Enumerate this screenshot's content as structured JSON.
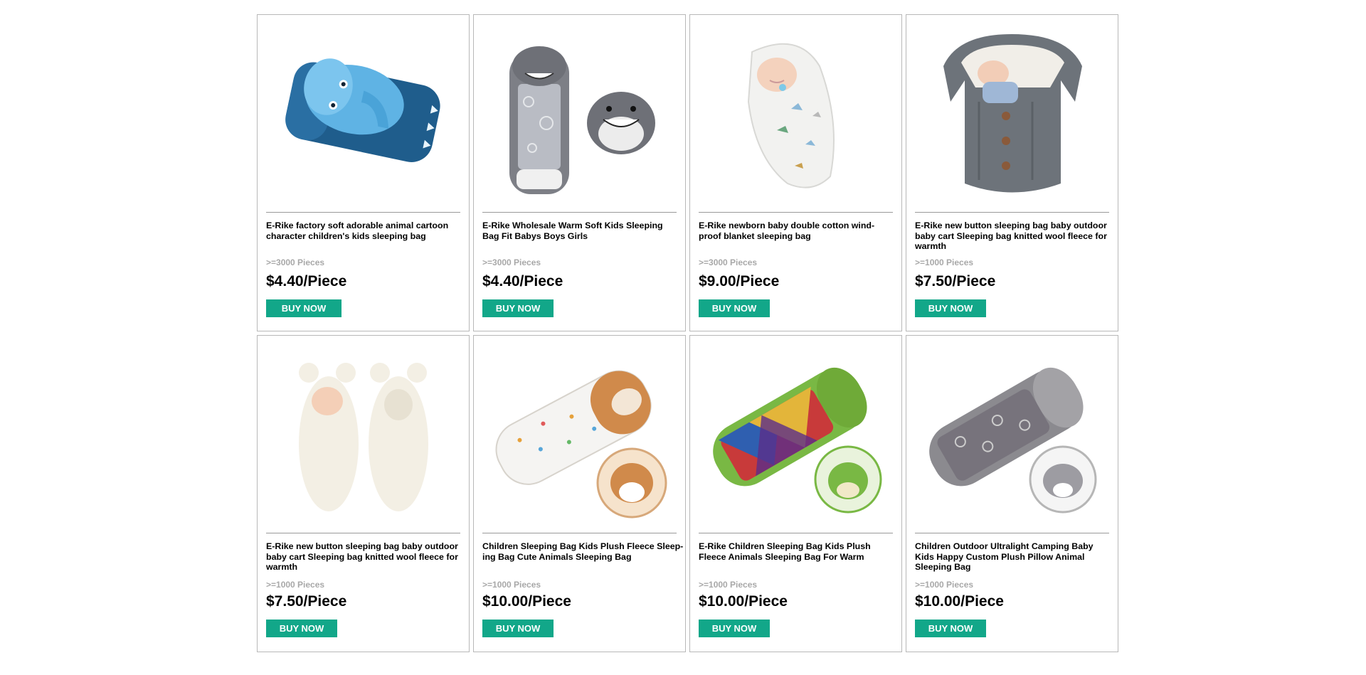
{
  "products": [
    {
      "title": "E-Rike factory soft adorable animal cartoon\ncharacter children's kids sleeping bag",
      "moq": ">=3000 Pieces",
      "price": "$4.40/Piece",
      "buy_label": "BUY NOW",
      "image": "elephant-sleeping-bag-image"
    },
    {
      "title": "E-Rike Wholesale Warm Soft Kids Sleeping\nBag Fit Babys Boys Girls",
      "moq": ">=3000 Pieces",
      "price": "$4.40/Piece",
      "buy_label": "BUY NOW",
      "image": "shark-sleeping-bag-image"
    },
    {
      "title": "E-Rike newborn baby double cotton wind-\nproof blanket sleeping bag",
      "moq": ">=3000 Pieces",
      "price": "$9.00/Piece",
      "buy_label": "BUY NOW",
      "image": "newborn-blanket-image"
    },
    {
      "title": "E-Rike new button sleeping bag baby outdoor\nbaby cart Sleeping bag knitted wool fleece for\nwarmth",
      "moq": ">=1000 Pieces",
      "price": "$7.50/Piece",
      "buy_label": "BUY NOW",
      "image": "knitted-sleeping-bag-image"
    },
    {
      "title": "E-Rike new button sleeping bag baby outdoor\nbaby cart Sleeping bag knitted wool fleece for\nwarmth",
      "moq": ">=1000 Pieces",
      "price": "$7.50/Piece",
      "buy_label": "BUY NOW",
      "image": "fleece-bear-wrap-image"
    },
    {
      "title": "Children Sleeping Bag Kids Plush Fleece Sleep-\ning Bag Cute Animals Sleeping Bag",
      "moq": ">=1000 Pieces",
      "price": "$10.00/Piece",
      "buy_label": "BUY NOW",
      "image": "dog-sleeping-bag-image"
    },
    {
      "title": "E-Rike Children Sleeping Bag Kids Plush\nFleece Animals Sleeping Bag For Warm",
      "moq": ">=1000 Pieces",
      "price": "$10.00/Piece",
      "buy_label": "BUY NOW",
      "image": "dinosaur-sleeping-bag-image"
    },
    {
      "title": "Children Outdoor Ultralight Camping Baby\nKids Happy Custom Plush Pillow Animal\nSleeping Bag",
      "moq": ">=1000 Pieces",
      "price": "$10.00/Piece",
      "buy_label": "BUY NOW",
      "image": "elephant-pillow-sleeping-bag-image"
    }
  ],
  "colors": {
    "buy_button": "#12a789",
    "moq_text": "#a8a8a8",
    "card_border": "#b8b8b8"
  }
}
